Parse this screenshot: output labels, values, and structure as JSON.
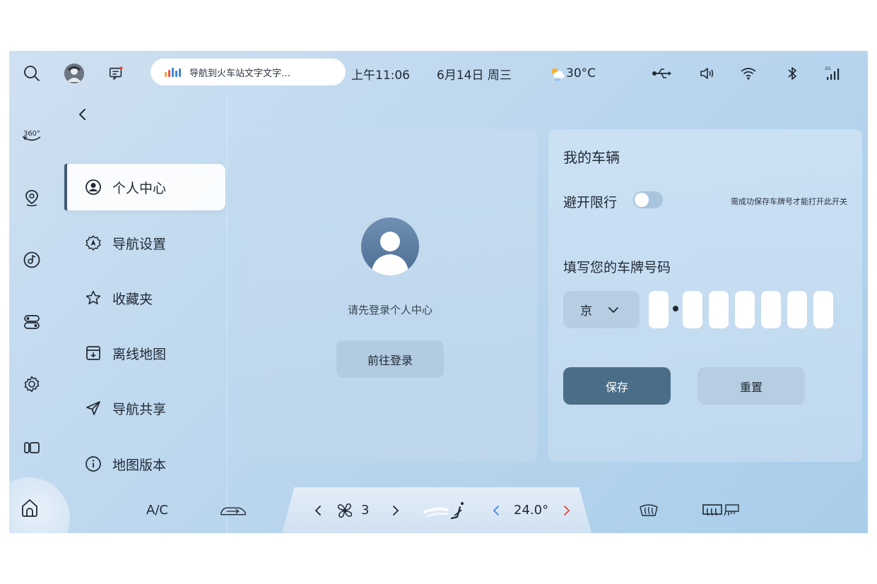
{
  "status_bar": {
    "nav_notification": "导航到火车站文字文字…",
    "time": "上午11:06",
    "date": "6月14日 周三",
    "temperature": "30°C",
    "signal_label": "2G"
  },
  "rail": {
    "icons": [
      "search-icon",
      "360-view-icon",
      "map-pin-icon",
      "music-icon",
      "toggle-settings-icon",
      "gear-icon",
      "apps-icon",
      "home-icon"
    ],
    "view360_label": "360°"
  },
  "menu": {
    "items": [
      {
        "label": "个人中心",
        "icon": "user-circle-icon",
        "active": true
      },
      {
        "label": "导航设置",
        "icon": "nav-settings-icon",
        "active": false
      },
      {
        "label": "收藏夹",
        "icon": "star-icon",
        "active": false
      },
      {
        "label": "离线地图",
        "icon": "download-box-icon",
        "active": false
      },
      {
        "label": "导航共享",
        "icon": "send-icon",
        "active": false
      },
      {
        "label": "地图版本",
        "icon": "info-icon",
        "active": false
      }
    ]
  },
  "login": {
    "hint": "请先登录个人中心",
    "button": "前往登录"
  },
  "vehicle": {
    "title": "我的车辆",
    "avoid_label": "避开限行",
    "avoid_enabled": false,
    "avoid_note": "需成功保存车牌号才能打开此开关",
    "plate_label": "填写您的车牌号码",
    "province": "京",
    "save_button": "保存",
    "reset_button": "重置"
  },
  "dock": {
    "ac_label": "A/C",
    "fan_level": "3",
    "temperature": "24.0°"
  },
  "colors": {
    "accent": "#4a6e87",
    "nav_bars": [
      "#f3a533",
      "#e5544b",
      "#3f86e0",
      "#3f86e0",
      "#3f86e0"
    ],
    "temp_up": "#e2463b",
    "temp_down": "#3f86e0"
  }
}
